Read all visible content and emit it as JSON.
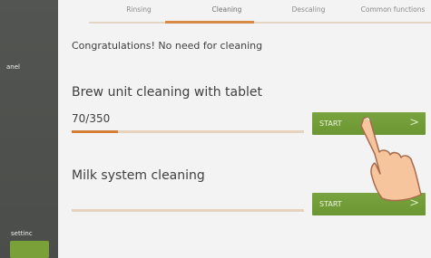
{
  "sidebar": {
    "label_panel": "anel",
    "label_setting": "settinc"
  },
  "tabs": [
    "Rinsing",
    "Cleaning",
    "Descaling",
    "Common functions"
  ],
  "active_tab": "Cleaning",
  "status_message": "Congratulations! No need for cleaning",
  "brew": {
    "title": "Brew unit cleaning with tablet",
    "counter": "70/350",
    "progress": 0.2,
    "button": "START",
    "chevron": ">"
  },
  "milk": {
    "title": "Milk system cleaning",
    "progress": 0.0,
    "button": "START",
    "chevron": ">"
  },
  "colors": {
    "accent": "#d47e37",
    "button": "#6f9a35",
    "sidebar": "#4f514e"
  },
  "icons": [
    "hand-pointer-icon",
    "chevron-right-icon"
  ]
}
